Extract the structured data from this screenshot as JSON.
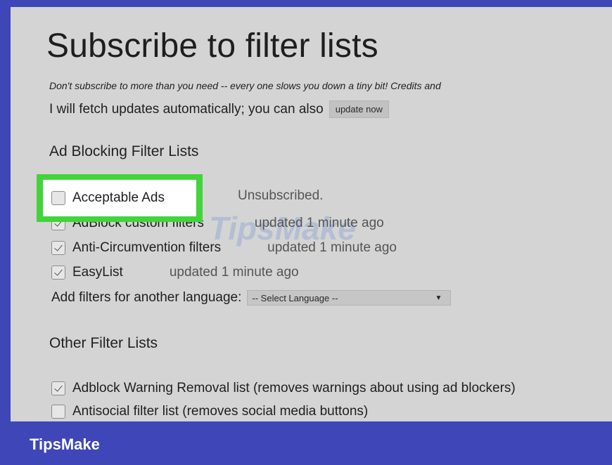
{
  "page": {
    "title": "Subscribe to filter lists",
    "note": "Don't subscribe to more than you need -- every one slows you down a tiny bit! Credits and",
    "fetch_text": "I will fetch updates automatically; you can also",
    "update_button": "update now"
  },
  "ad_blocking": {
    "heading": "Ad Blocking Filter Lists",
    "items": [
      {
        "label": "Acceptable Ads",
        "status": "Unsubscribed.",
        "checked": false,
        "highlighted": true
      },
      {
        "label": "AdBlock custom filters",
        "status": "updated 1 minute ago",
        "checked": true
      },
      {
        "label": "Anti-Circumvention filters",
        "status": "updated 1 minute ago",
        "checked": true
      },
      {
        "label": "EasyList",
        "status": "updated 1 minute ago",
        "checked": true
      }
    ],
    "language_label": "Add filters for another language:",
    "language_select": "-- Select Language --"
  },
  "other": {
    "heading": "Other Filter Lists",
    "items": [
      {
        "label": "Adblock Warning Removal list (removes warnings about using ad blockers)",
        "checked": true
      },
      {
        "label": "Antisocial filter list (removes social media buttons)",
        "checked": false
      }
    ]
  },
  "watermark": "TipsMake",
  "footer": {
    "brand": "TipsMake"
  },
  "colors": {
    "frame_bg": "#3f46b7",
    "highlight": "#42d43b",
    "panel": "#d4d4d4"
  }
}
